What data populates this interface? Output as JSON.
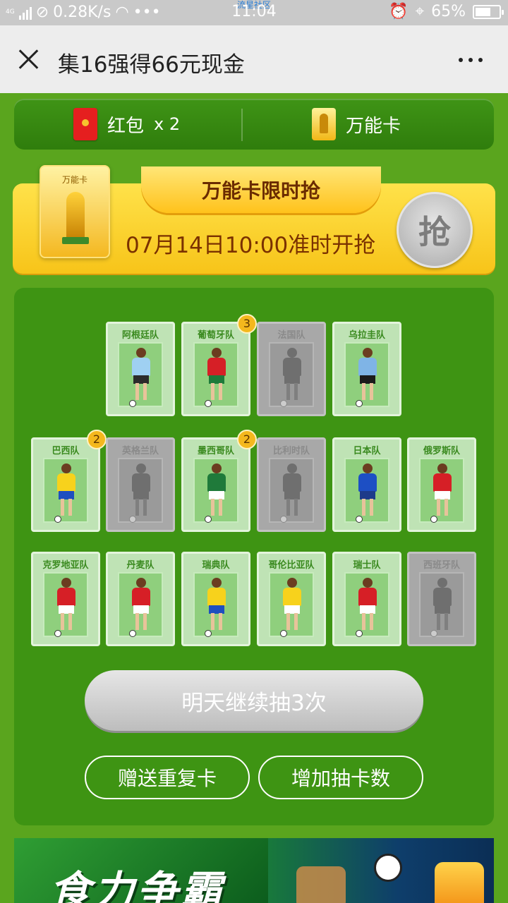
{
  "status_bar": {
    "network_type": "4G",
    "speed": "0.28K/s",
    "overflow_dots": "•••",
    "time": "11:04",
    "overlay_text": "流星社区",
    "battery": "65%",
    "battery_level": 0.65
  },
  "nav": {
    "title": "集16强得66元现金",
    "close_icon": "close-icon",
    "more_icon": "more-icon"
  },
  "inventory": {
    "red_packet_label": "红包",
    "red_packet_count": "x 2",
    "wild_card_label": "万能卡"
  },
  "banner": {
    "card_label": "万能卡",
    "ribbon_title": "万能卡限时抢",
    "countdown_text": "07月14日10:00准时开抢",
    "grab_button": "抢"
  },
  "team_cards": [
    {
      "team": "阿根廷队",
      "owned": true,
      "count": null,
      "shirt": "#9fd0f2",
      "shorts": "#2b2b2b"
    },
    {
      "team": "葡萄牙队",
      "owned": true,
      "count": "3",
      "shirt": "#d61f26",
      "shorts": "#1e7a3a"
    },
    {
      "team": "法国队",
      "owned": false,
      "count": null,
      "shirt": "#777",
      "shorts": "#777"
    },
    {
      "team": "乌拉圭队",
      "owned": true,
      "count": null,
      "shirt": "#7fb4e6",
      "shorts": "#1b1b1b"
    },
    {
      "team": "巴西队",
      "owned": true,
      "count": "2",
      "shirt": "#f7d21c",
      "shorts": "#1f4fbf"
    },
    {
      "team": "英格兰队",
      "owned": false,
      "count": null,
      "shirt": "#777",
      "shorts": "#777"
    },
    {
      "team": "墨西哥队",
      "owned": true,
      "count": "2",
      "shirt": "#1f7a3a",
      "shorts": "#ffffff"
    },
    {
      "team": "比利时队",
      "owned": false,
      "count": null,
      "shirt": "#777",
      "shorts": "#777"
    },
    {
      "team": "日本队",
      "owned": true,
      "count": null,
      "shirt": "#1d4fc4",
      "shorts": "#1d3b8a"
    },
    {
      "team": "俄罗斯队",
      "owned": true,
      "count": null,
      "shirt": "#d61f26",
      "shorts": "#ffffff"
    },
    {
      "team": "克罗地亚队",
      "owned": true,
      "count": null,
      "shirt": "#d61f26",
      "shorts": "#ffffff"
    },
    {
      "team": "丹麦队",
      "owned": true,
      "count": null,
      "shirt": "#d61f26",
      "shorts": "#ffffff"
    },
    {
      "team": "瑞典队",
      "owned": true,
      "count": null,
      "shirt": "#f7d21c",
      "shorts": "#1f4fbf"
    },
    {
      "team": "哥伦比亚队",
      "owned": true,
      "count": null,
      "shirt": "#f7d21c",
      "shorts": "#ffffff"
    },
    {
      "team": "瑞士队",
      "owned": true,
      "count": null,
      "shirt": "#d61f26",
      "shorts": "#ffffff"
    },
    {
      "team": "西班牙队",
      "owned": false,
      "count": null,
      "shirt": "#777",
      "shorts": "#777"
    }
  ],
  "actions": {
    "draw_button": "明天继续抽3次",
    "gift_button": "赠送重复卡",
    "add_draws_button": "增加抽卡数"
  },
  "ad": {
    "slogan": "食力争霸"
  }
}
